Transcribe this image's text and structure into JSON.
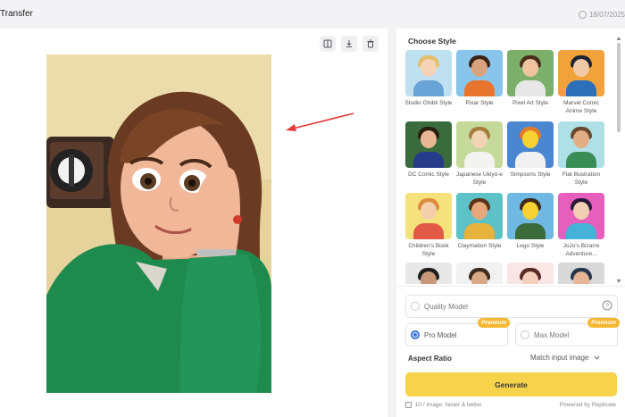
{
  "header": {
    "title": "Transfer",
    "date": "18/07/2025"
  },
  "toolbar": {
    "compare_icon": "compare-icon",
    "download_icon": "download-icon",
    "delete_icon": "trash-icon"
  },
  "style_panel": {
    "title": "Choose Style",
    "styles": [
      {
        "label": "Studio Ghibli Style",
        "bg": "#bfe0f0",
        "skin": "#f4d3b8",
        "hair": "#e2c06a",
        "shirt": "#6aa3d6"
      },
      {
        "label": "Pixar Style",
        "bg": "#89c4ea",
        "skin": "#d9a27c",
        "hair": "#3a2417",
        "shirt": "#e9742e"
      },
      {
        "label": "Pixel Art Style",
        "bg": "#7cb06a",
        "skin": "#efc39f",
        "hair": "#4a2d1a",
        "shirt": "#e7e7e7"
      },
      {
        "label": "Marvel Comic Anime Style",
        "bg": "#f2a23b",
        "skin": "#f0c9a6",
        "hair": "#1d2530",
        "shirt": "#2e6fba"
      },
      {
        "label": "DC Comic Style",
        "bg": "#3a6b3c",
        "skin": "#e8b894",
        "hair": "#2b1c12",
        "shirt": "#263b8a"
      },
      {
        "label": "Japanese Ukiyo-e Style",
        "bg": "#c4d99a",
        "skin": "#f1d4b3",
        "hair": "#a67c3a",
        "shirt": "#f3f3ef"
      },
      {
        "label": "Simpsons Style",
        "bg": "#4b86d1",
        "skin": "#f6d232",
        "hair": "#e27a2a",
        "shirt": "#f1f1f1"
      },
      {
        "label": "Flat Illustration Style",
        "bg": "#aee0e6",
        "skin": "#e3ae86",
        "hair": "#6a4a2e",
        "shirt": "#3a8d57"
      },
      {
        "label": "Children's Book Style",
        "bg": "#f5e27d",
        "skin": "#f4cfae",
        "hair": "#de8a3a",
        "shirt": "#e25a47"
      },
      {
        "label": "Claymation Style",
        "bg": "#5cc2c8",
        "skin": "#e6a87a",
        "hair": "#5a3218",
        "shirt": "#e8b33c"
      },
      {
        "label": "Lego Style",
        "bg": "#6fb8e3",
        "skin": "#f6d232",
        "hair": "#3e2b1a",
        "shirt": "#3b6b3a"
      },
      {
        "label": "JoJo's Bizarre Adventure...",
        "bg": "#e65fbd",
        "skin": "#f1cfb4",
        "hair": "#2a1a3a",
        "shirt": "#45b3d8"
      },
      {
        "label": "",
        "bg": "#e8e8e8",
        "skin": "#c89878",
        "hair": "#1f1f1f",
        "shirt": "#7a7a7a"
      },
      {
        "label": "",
        "bg": "#f1f1f1",
        "skin": "#d8a887",
        "hair": "#3a2a1a",
        "shirt": "#3e9b4f"
      },
      {
        "label": "",
        "bg": "#fbe6e6",
        "skin": "#f4d0bc",
        "hair": "#5a2a22",
        "shirt": "#e6e6e6"
      },
      {
        "label": "",
        "bg": "#d9d9d9",
        "skin": "#e4b596",
        "hair": "#25354a",
        "shirt": "#555555"
      }
    ]
  },
  "models": {
    "quality": "Quality Model",
    "pro": "Pro Model",
    "max": "Max Model",
    "premium_badge": "Premium"
  },
  "aspect_ratio": {
    "label": "Aspect Ratio",
    "value": "Match input image"
  },
  "generate_label": "Generate",
  "footer": {
    "cost": "10 / image, faster & better",
    "powered": "Powered by Replicate"
  },
  "colors": {
    "accent": "#f7d34c",
    "premium": "#f5b731",
    "selected_radio": "#3a74d8"
  }
}
